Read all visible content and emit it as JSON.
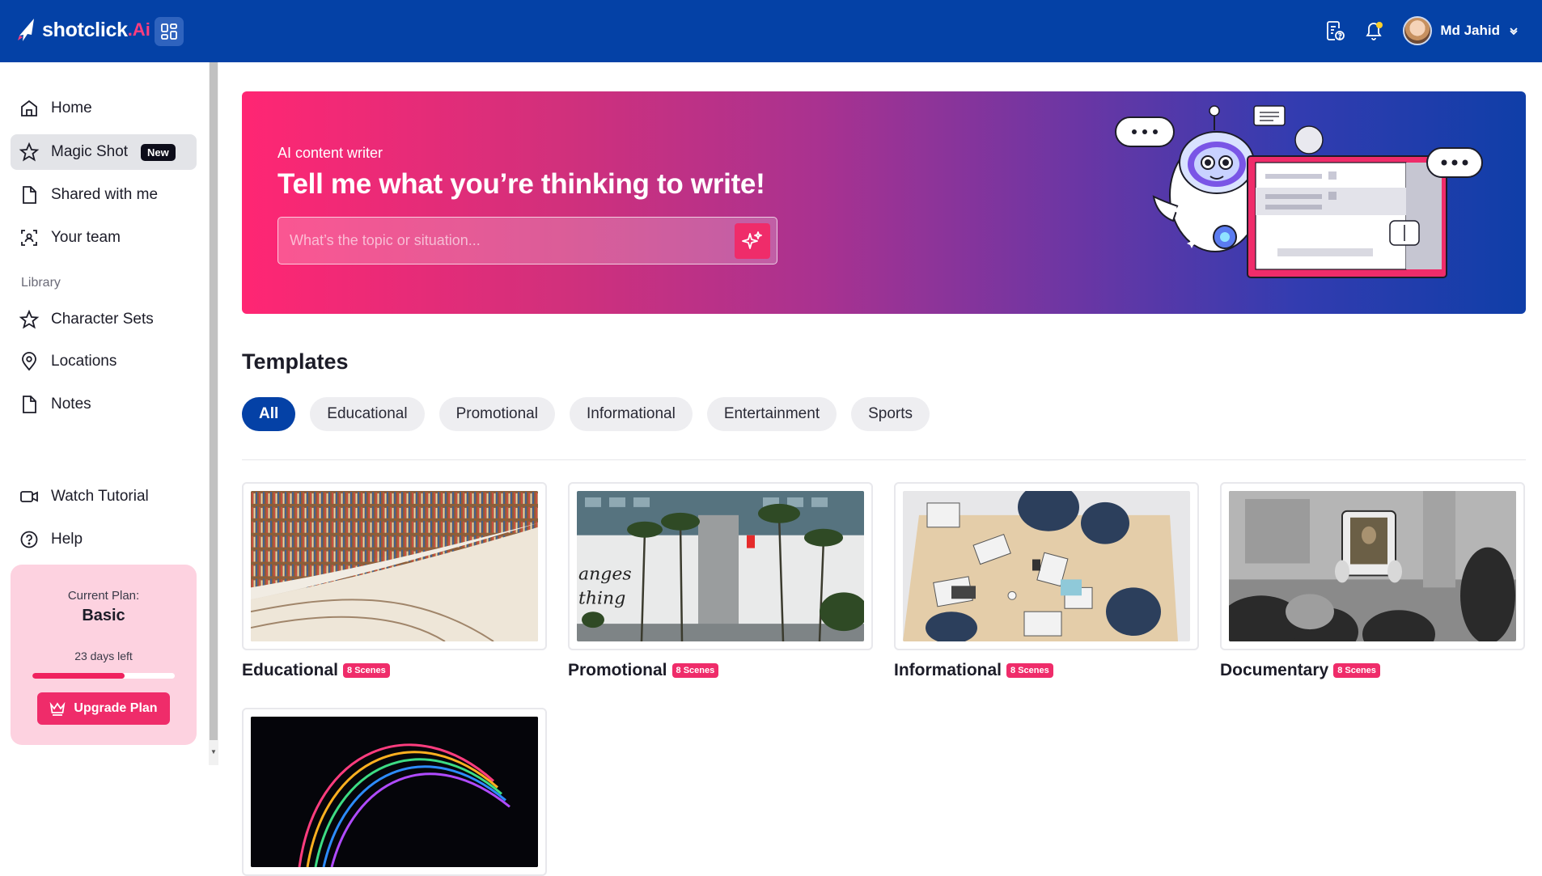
{
  "brand": {
    "name": "shotclick",
    "suffix": ".Ai"
  },
  "header": {
    "user_name": "Md Jahid",
    "icons": [
      "document-help-icon",
      "bell-icon",
      "chevron-down-icon"
    ]
  },
  "sidebar": {
    "items": [
      {
        "label": "Home",
        "icon": "home-icon"
      },
      {
        "label": "Magic Shot",
        "icon": "star-icon",
        "badge": "New",
        "active": true
      },
      {
        "label": "Shared with me",
        "icon": "file-icon"
      },
      {
        "label": "Your team",
        "icon": "team-scan-icon"
      }
    ],
    "library_label": "Library",
    "library_items": [
      {
        "label": "Character Sets",
        "icon": "star-icon"
      },
      {
        "label": "Locations",
        "icon": "location-pin-icon"
      },
      {
        "label": "Notes",
        "icon": "file-icon"
      }
    ],
    "bottom_items": [
      {
        "label": "Watch Tutorial",
        "icon": "video-icon"
      },
      {
        "label": "Help",
        "icon": "help-circle-icon"
      }
    ],
    "plan": {
      "label": "Current Plan:",
      "name": "Basic",
      "days_left": "23 days left",
      "progress_fraction": 0.65,
      "upgrade_label": "Upgrade Plan"
    }
  },
  "hero": {
    "eyebrow": "AI content writer",
    "title": "Tell me what you’re thinking to write!",
    "input_placeholder": "What’s the topic or situation...",
    "input_value": ""
  },
  "templates": {
    "title": "Templates",
    "filters": [
      "All",
      "Educational",
      "Promotional",
      "Informational",
      "Entertainment",
      "Sports"
    ],
    "active_filter": "All",
    "cards": [
      {
        "title": "Educational",
        "badge": "8 Scenes",
        "image": "library-bookshelves"
      },
      {
        "title": "Promotional",
        "badge": "8 Scenes",
        "image": "city-palm-trees"
      },
      {
        "title": "Informational",
        "badge": "8 Scenes",
        "image": "office-meeting-table"
      },
      {
        "title": "Documentary",
        "badge": "8 Scenes",
        "image": "museum-mona-lisa"
      },
      {
        "title": "",
        "badge": "",
        "image": "colorful-light-trails"
      }
    ]
  },
  "colors": {
    "header_bg": "#0441a6",
    "accent_pink": "#ef2c6a",
    "plan_card_bg": "#fdd2e0",
    "chip_bg": "#eeeef1"
  }
}
